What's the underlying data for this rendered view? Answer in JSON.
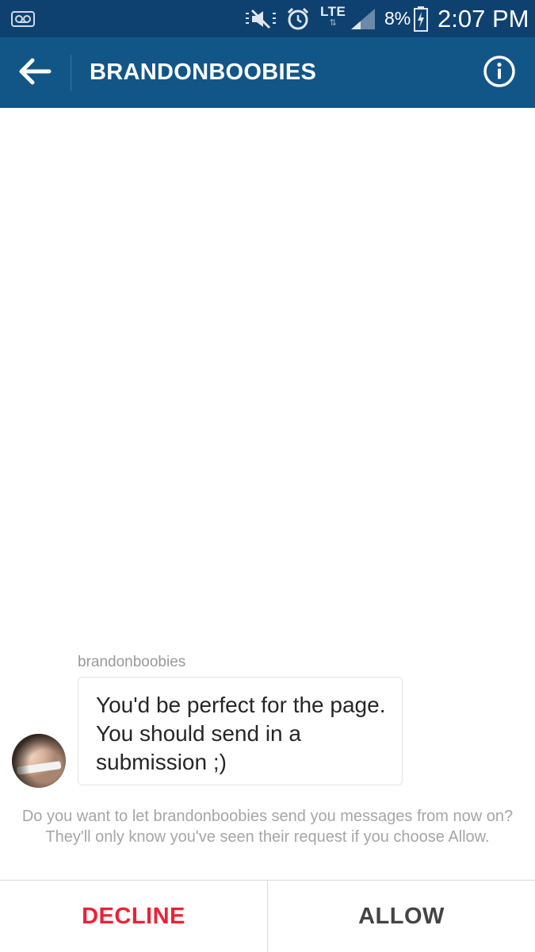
{
  "status_bar": {
    "network": "LTE",
    "battery": "8%",
    "time": "2:07 PM",
    "icons": [
      "voicemail-icon",
      "mute-vibrate-icon",
      "alarm-icon",
      "signal-icon",
      "battery-charging-icon"
    ]
  },
  "header": {
    "title": "BRANDONBOOBIES",
    "back_icon": "back-arrow-icon",
    "info_icon": "info-icon",
    "background": "#125688",
    "status_background": "#0f4170"
  },
  "thread": {
    "sender": "brandonboobies",
    "message": "You'd be perfect for the page. You should send in a submission ;)"
  },
  "request": {
    "prompt": "Do you want to let brandonboobies send you messages from now on? They'll only know you've seen their request if you choose Allow."
  },
  "actions": {
    "decline_label": "DECLINE",
    "allow_label": "ALLOW",
    "decline_color": "#ed2136"
  }
}
